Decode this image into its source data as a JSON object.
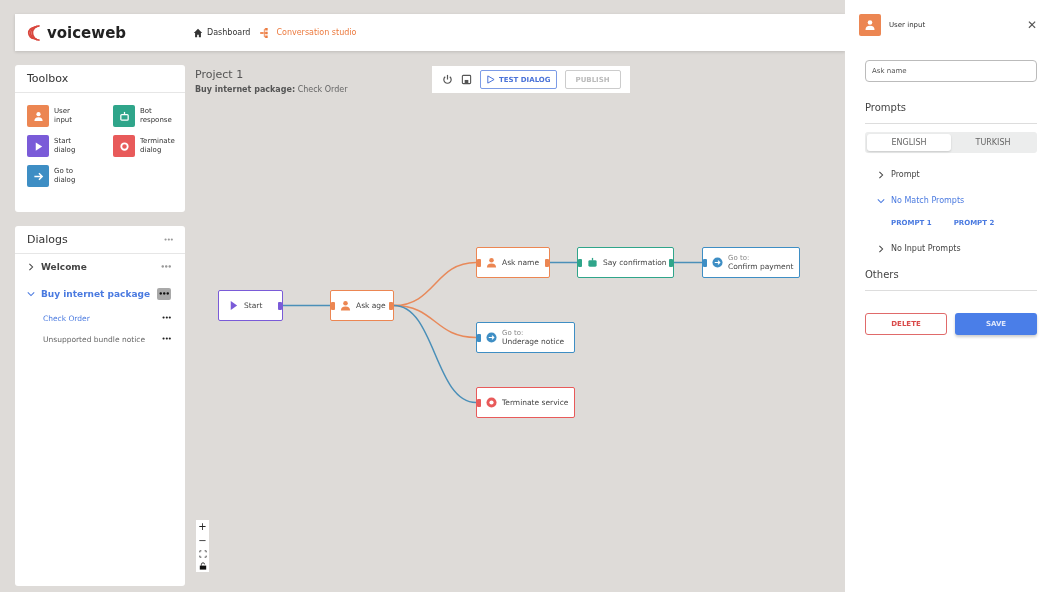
{
  "header": {
    "logo": "voiceweb",
    "nav": [
      {
        "label": "Dashboard",
        "selected": false
      },
      {
        "label": "Conversation studio",
        "selected": true
      }
    ]
  },
  "toolbox": {
    "title": "Toolbox",
    "items": [
      {
        "label": "User input",
        "kind": "input"
      },
      {
        "label": "Bot response",
        "kind": "bot"
      },
      {
        "label": "Start dialog",
        "kind": "start"
      },
      {
        "label": "Terminate dialog",
        "kind": "terminate"
      },
      {
        "label": "Go to dialog",
        "kind": "goto"
      }
    ]
  },
  "dialogs": {
    "title": "Dialogs",
    "menu": "•••",
    "items": [
      {
        "label": "Welcome",
        "expanded": false,
        "selected": false,
        "menu": "•••",
        "highlighted_menu": false
      },
      {
        "label": "Buy internet package",
        "expanded": true,
        "selected": true,
        "menu": "•••",
        "highlighted_menu": true,
        "children": [
          {
            "label": "Check Order",
            "selected": true,
            "menu": "•••"
          },
          {
            "label": "Unsupported bundle notice",
            "selected": false,
            "menu": "•••"
          }
        ]
      }
    ]
  },
  "canvas": {
    "project": "Project 1",
    "breadcrumb_parent": "Buy internet package:",
    "breadcrumb_child": "Check Order",
    "toolbar": {
      "test_label": "TEST DIALOG",
      "publish_label": "PUBLISH",
      "publish_disabled": true
    },
    "nodes": [
      {
        "kind": "start",
        "label": "Start"
      },
      {
        "kind": "input",
        "label": "Ask age"
      },
      {
        "kind": "input",
        "label": "Ask name"
      },
      {
        "kind": "bot",
        "label": "Say confirmation"
      },
      {
        "kind": "goto",
        "caption": "Go to:",
        "label": "Confirm payment"
      },
      {
        "kind": "goto",
        "caption": "Go to:",
        "label": "Underage notice"
      },
      {
        "kind": "terminate",
        "label": "Terminate service"
      }
    ],
    "zoom_controls": [
      "+",
      "−"
    ]
  },
  "panel": {
    "title": "User input",
    "kind": "input",
    "close": "✕",
    "name_value": "Ask name",
    "prompts_title": "Prompts",
    "tabs": [
      {
        "label": "ENGLISH",
        "selected": true
      },
      {
        "label": "TURKISH",
        "selected": false
      }
    ],
    "sections": [
      {
        "label": "Prompt",
        "expanded": false
      },
      {
        "label": "No Match Prompts",
        "expanded": true,
        "chips": [
          "PROMPT 1",
          "PROMPT 2"
        ]
      },
      {
        "label": "No Input Prompts",
        "expanded": false
      }
    ],
    "others_title": "Others",
    "delete_label": "DELETE",
    "save_label": "SAVE"
  }
}
